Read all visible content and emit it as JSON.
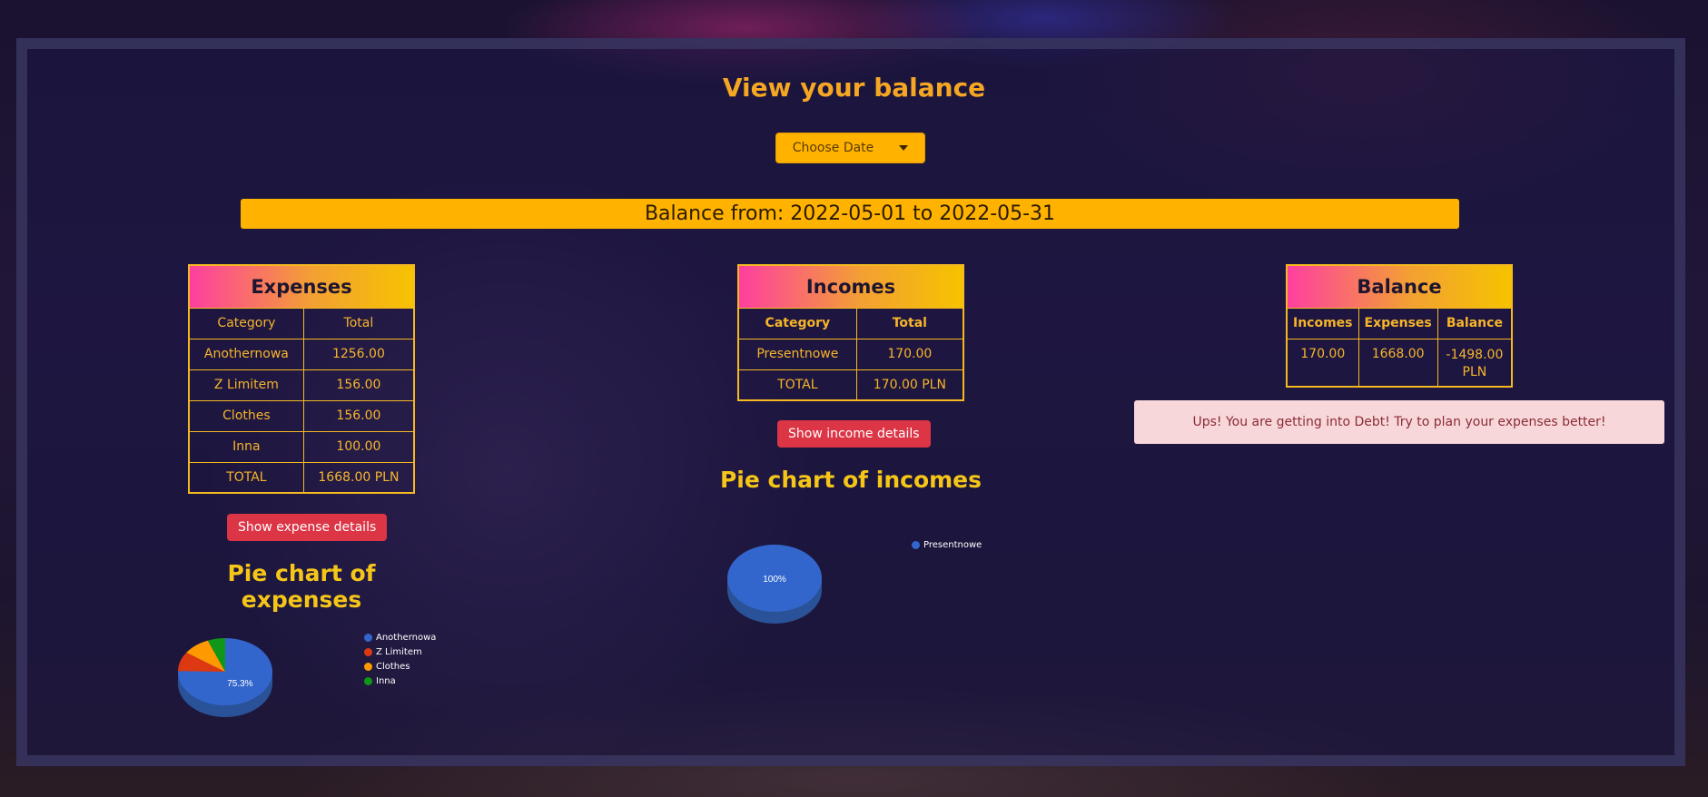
{
  "page": {
    "title": "View your balance",
    "date_button": "Choose Date",
    "balance_range": "Balance from: 2022-05-01 to 2022-05-31"
  },
  "expenses": {
    "heading": "Expenses",
    "columns": [
      "Category",
      "Total"
    ],
    "rows": [
      {
        "category": "Anothernowa",
        "total": "1256.00"
      },
      {
        "category": "Z Limitem",
        "total": "156.00"
      },
      {
        "category": "Clothes",
        "total": "156.00"
      },
      {
        "category": "Inna",
        "total": "100.00"
      }
    ],
    "total_label": "TOTAL",
    "total_value": "1668.00 PLN",
    "details_button": "Show expense details",
    "chart_title": "Pie chart of expenses"
  },
  "incomes": {
    "heading": "Incomes",
    "columns": [
      "Category",
      "Total"
    ],
    "rows": [
      {
        "category": "Presentnowe",
        "total": "170.00"
      }
    ],
    "total_label": "TOTAL",
    "total_value": "170.00 PLN",
    "details_button": "Show income details",
    "chart_title": "Pie chart of incomes"
  },
  "balance": {
    "heading": "Balance",
    "columns": [
      "Incomes",
      "Expenses",
      "Balance"
    ],
    "values": {
      "incomes": "170.00",
      "expenses": "1668.00",
      "balance": "-1498.00 PLN"
    },
    "alert": "Ups! You are getting into Debt! Try to plan your expenses better!"
  },
  "colors": {
    "accent": "#ffb300",
    "danger": "#dc3545",
    "series": [
      "#3366cc",
      "#dc3912",
      "#ff9900",
      "#109618"
    ]
  },
  "chart_data": [
    {
      "type": "pie",
      "categories": [
        "Anothernowa",
        "Z Limitem",
        "Clothes",
        "Inna"
      ],
      "values": [
        1256.0,
        156.0,
        156.0,
        100.0
      ],
      "slice_labels": [
        "75.3%",
        "",
        "",
        ""
      ],
      "title": "Pie chart of expenses",
      "legend": "right"
    },
    {
      "type": "pie",
      "categories": [
        "Presentnowe"
      ],
      "values": [
        170.0
      ],
      "slice_labels": [
        "100%"
      ],
      "title": "Pie chart of incomes",
      "legend": "right"
    }
  ]
}
